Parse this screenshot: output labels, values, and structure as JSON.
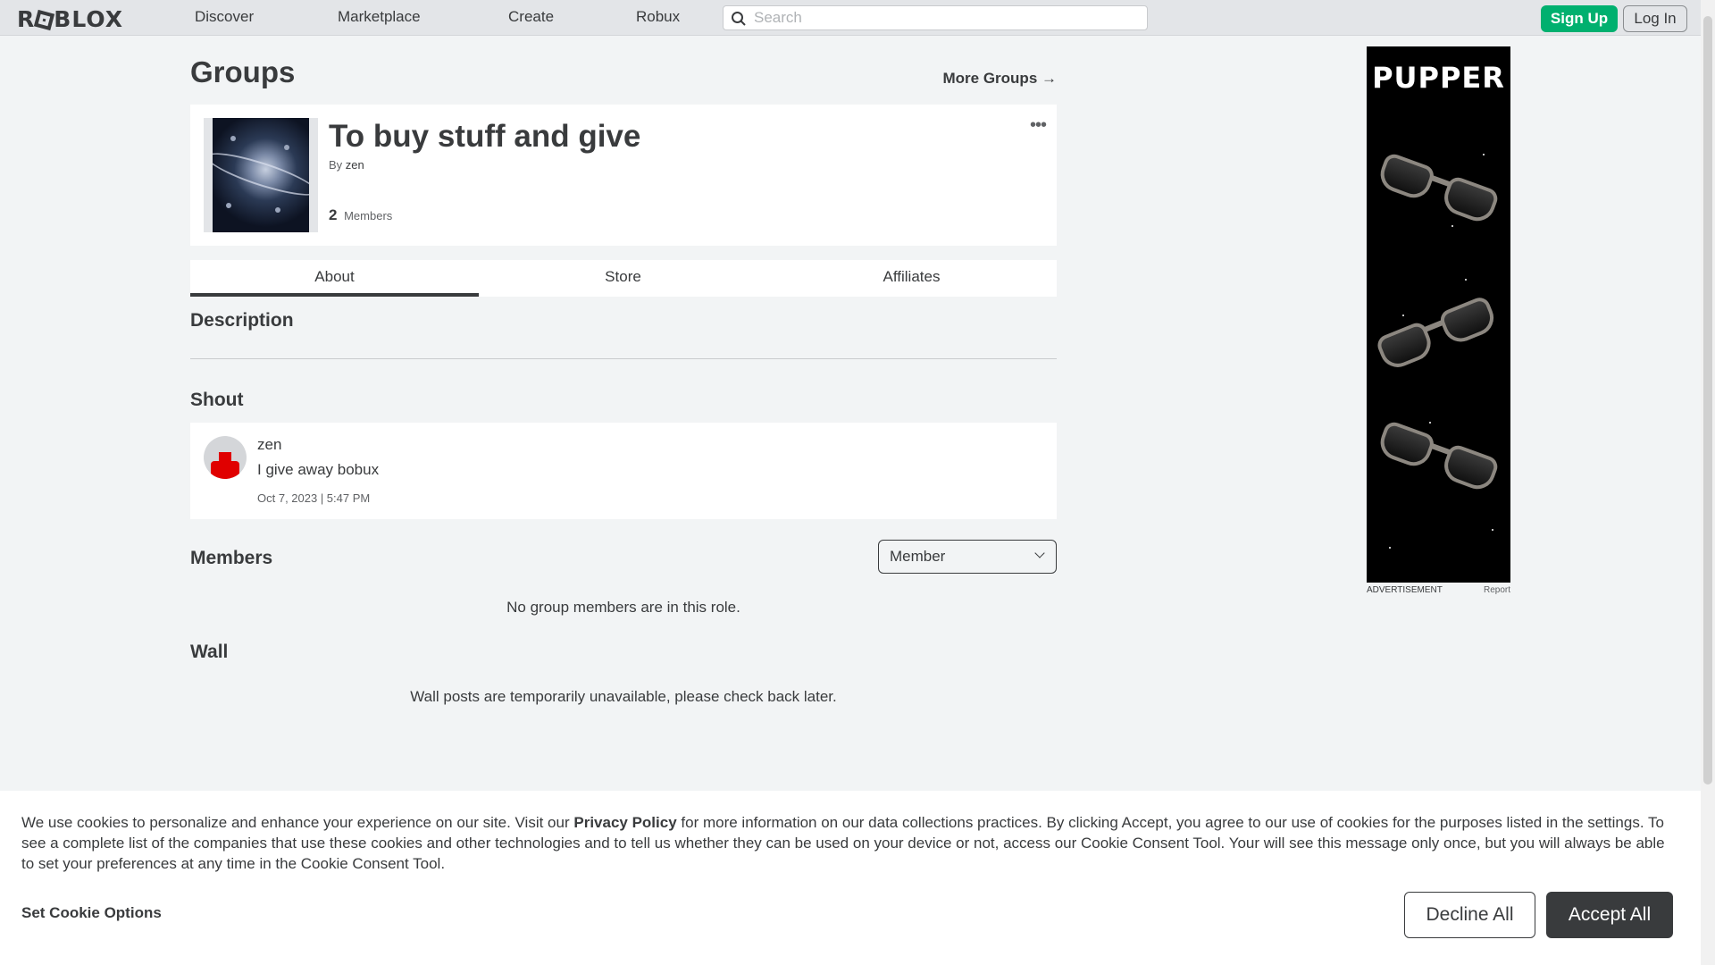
{
  "nav": {
    "logo": "ROBLOX",
    "links": [
      "Discover",
      "Marketplace",
      "Create",
      "Robux"
    ],
    "search_placeholder": "Search",
    "signup": "Sign Up",
    "login": "Log In"
  },
  "page": {
    "title": "Groups",
    "more_groups": "More Groups →"
  },
  "group": {
    "name": "To buy stuff and give",
    "by_label": "By",
    "owner": "zen",
    "member_count": "2",
    "members_label": "Members",
    "menu": "•••"
  },
  "tabs": [
    "About",
    "Store",
    "Affiliates"
  ],
  "sections": {
    "description": "Description",
    "shout": "Shout",
    "members": "Members",
    "wall": "Wall"
  },
  "shout": {
    "user": "zen",
    "text": "I give away bobux",
    "date": "Oct 7, 2023 | 5:47 PM"
  },
  "members": {
    "role_selected": "Member",
    "empty_message": "No group members are in this role."
  },
  "wall": {
    "message": "Wall posts are temporarily unavailable, please check back later."
  },
  "ad": {
    "title": "PUPPER",
    "label": "ADVERTISEMENT",
    "report": "Report"
  },
  "cookie": {
    "text_before": "We use cookies to personalize and enhance your experience on our site. Visit our ",
    "policy_link": "Privacy Policy",
    "text_after": " for more information on our data collections practices. By clicking Accept, you agree to our use of cookies for the purposes listed in the settings. To see a complete list of the companies that use these cookies and other technologies and to tell us whether they can be used on your device or not, access our Cookie Consent Tool. Your will see this message only once, but you will always be able to set your preferences at any time in the Cookie Consent Tool.",
    "set_options": "Set Cookie Options",
    "decline": "Decline All",
    "accept": "Accept All"
  },
  "colors": {
    "signup_green": "#00b06f",
    "accent_dark": "#393b3d",
    "page_bg": "#f2f4f5"
  }
}
